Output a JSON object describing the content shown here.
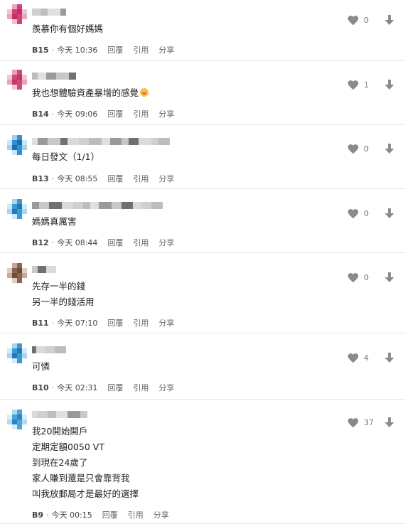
{
  "comments": [
    {
      "floor": "B15",
      "time": "今天 10:36",
      "likes": "0",
      "lines": [
        "羨慕你有個好媽媽"
      ],
      "emoji": false,
      "actions": [
        "回覆",
        "引用",
        "分享"
      ]
    },
    {
      "floor": "B14",
      "time": "今天 09:06",
      "likes": "1",
      "lines": [
        "我也想體驗資產暴增的感覺"
      ],
      "emoji": true,
      "actions": [
        "回覆",
        "引用",
        "分享"
      ]
    },
    {
      "floor": "B13",
      "time": "今天 08:55",
      "likes": "0",
      "lines": [
        "每日發文（1/1）"
      ],
      "emoji": false,
      "actions": [
        "回覆",
        "引用",
        "分享"
      ]
    },
    {
      "floor": "B12",
      "time": "今天 08:44",
      "likes": "0",
      "lines": [
        "媽媽真厲害"
      ],
      "emoji": false,
      "actions": [
        "回覆",
        "引用",
        "分享"
      ]
    },
    {
      "floor": "B11",
      "time": "今天 07:10",
      "likes": "0",
      "lines": [
        "先存一半的錢",
        "另一半的錢活用"
      ],
      "emoji": false,
      "actions": [
        "回覆",
        "引用",
        "分享"
      ]
    },
    {
      "floor": "B10",
      "time": "今天 02:31",
      "likes": "4",
      "lines": [
        "可憐"
      ],
      "emoji": false,
      "actions": [
        "回覆",
        "引用",
        "分享"
      ]
    },
    {
      "floor": "B9",
      "time": "今天 00:15",
      "likes": "37",
      "lines": [
        "我20開始開戶",
        "定期定額0050 VT",
        "到現在24歲了",
        "家人賺到還是只會靠背我",
        "叫我放郵局才是最好的選擇"
      ],
      "emoji": false,
      "actions": [
        "回覆",
        "引用",
        "分享"
      ]
    }
  ],
  "icons": {
    "like": "heart-icon",
    "dislike": "arrow-down-icon"
  },
  "colors": {
    "icon": "#8a8a8a",
    "divider": "#e6e6e6",
    "meta_text": "#666666"
  }
}
